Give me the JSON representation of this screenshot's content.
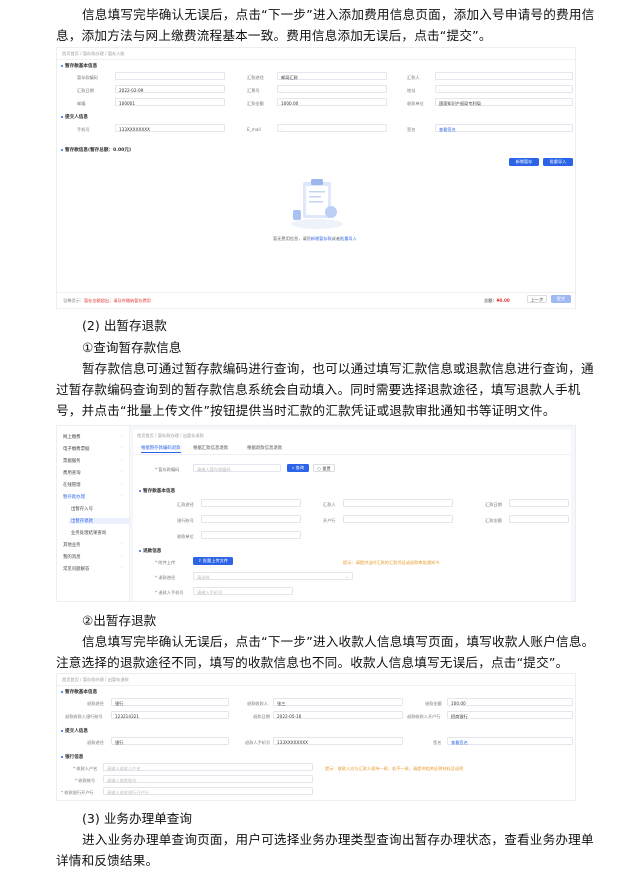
{
  "intro_para": "信息填写完毕确认无误后，点击“下一步”进入添加费用信息页面，添加入号申请号的费用信息，添加方法与网上缴费流程基本一致。费用信息添加无误后，点击“提交”。",
  "shot1": {
    "breadcrumb": "首页首页 / 暂存款办理 / 暂存入账",
    "section_basic": "暂存款基本信息",
    "basic_labels": [
      "暂存款编码",
      "汇款途径",
      "汇款人",
      "汇款日期",
      "汇票号",
      "地址",
      "邮编",
      "汇款金额",
      "收款单位"
    ],
    "basic_values": [
      "-",
      "邮局汇款",
      "-",
      "2022-02-09",
      "-",
      "-",
      "100001",
      "1000.00",
      "国家知识产权局专利局"
    ],
    "section_submitter": "提交人信息",
    "submitter_labels": [
      "手机号",
      "E_mail",
      "签名"
    ],
    "submitter_values": [
      "133XXXXXXXX",
      "-",
      "查看签名"
    ],
    "section_fee": "暂存款信息(暂存总额：0.00元)",
    "btn_add": "新增暂存",
    "btn_batch": "批量导入",
    "empty_text": "暂无费用信息，请您",
    "empty_link1": "新增暂存款",
    "empty_or": "或者",
    "empty_link2": "批量导入",
    "footer_warn": "温馨提示：",
    "footer_warn_text": "暂存金额超出，请及时缴纳暂存费用",
    "footer_total": "总额：",
    "footer_total_value": "¥0.00",
    "btn_prev": "上一步",
    "btn_submit": "提交"
  },
  "heading_2": "(2) 出暂存退款",
  "sub_heading_1": "①查询暂存款信息",
  "para_2": "暂存款信息可通过暂存款编码进行查询，也可以通过填写汇款信息或退款信息进行查询，通过暂存款编码查询到的暂存款信息系统会自动填入。同时需要选择退款途径，填写退款人手机号，并点击“批量上传文件”按钮提供当时汇款的汇款凭证或退款审批通知书等证明文件。",
  "shot2": {
    "sidebar": [
      "网上缴费",
      "电子缴费票据",
      "票据服务",
      "费用查询",
      "在线管理",
      "暂存款办理",
      "出暂存入号",
      "出暂存退款",
      "业务处理结果查询",
      "其他业务",
      "我的消息",
      "常见问题解答"
    ],
    "breadcrumb": "首页首页 / 暂存款办理 / 出暂存退款",
    "tabs": [
      "根据暂存款编码退款",
      "根据汇款信息退款",
      "根据退款信息退款"
    ],
    "search_label": "* 暂存款编码",
    "search_placeholder": "请输入暂存款编码",
    "btn_query": "查询",
    "btn_reset": "重置",
    "section_basic": "暂存款基本信息",
    "basic_labels": [
      "汇款途径",
      "汇款人",
      "汇款日期",
      "银行账号",
      "开户行",
      "汇款金额",
      "收款单位"
    ],
    "section_refund": "退款信息",
    "upload_label": "* 附件上传",
    "btn_upload": "批量上传文件",
    "upload_tip": "提示：请提供当时汇款的汇款凭证或退款审批通知书",
    "refund_way_label": "* 退款途径",
    "refund_way_placeholder": "请选择",
    "phone_label": "* 退款人手机号",
    "phone_placeholder": "请输入手机号"
  },
  "sub_heading_2": "②出暂存退款",
  "para_3": "信息填写完毕确认无误后，点击“下一步”进入收款人信息填写页面，填写收款人账户信息。注意选择的退款途径不同，填写的收款信息也不同。收款人信息填写无误后，点击“提交”。",
  "shot3": {
    "breadcrumb": "首页首页 / 暂存款办理 / 出暂存退款",
    "section_basic": "暂存款基本信息",
    "basic_labels": [
      "退款途径",
      "退款收款人",
      "退款金额",
      "退款收款人银行账号",
      "退款日期",
      "退款收款人开户行"
    ],
    "basic_values": [
      "银行",
      "张三",
      "100.00",
      "123214321",
      "2022-05-16",
      "招商银行"
    ],
    "section_submitter": "提交人信息",
    "submitter_labels": [
      "退款途径",
      "退款人手机号",
      "签名"
    ],
    "submitter_values": [
      "银行",
      "133XXXXXXXX",
      "查看签名"
    ],
    "section_refund": "银行信息",
    "refund_labels": [
      "* 收款人户名",
      "* 收款账号",
      "* 收款银行开户行"
    ],
    "refund_placeholders": [
      "请输入收款人户名",
      "请输入收款账号",
      "请输入收款银行开户行"
    ],
    "refund_tip": "提示：收款人应与汇款人保持一致，若不一致，请提供相关证明材料及说明"
  },
  "heading_3": "(3) 业务办理单查询",
  "para_4": "进入业务办理单查询页面，用户可选择业务办理类型查询出暂存办理状态，查看业务办理单详情和反馈结果。"
}
